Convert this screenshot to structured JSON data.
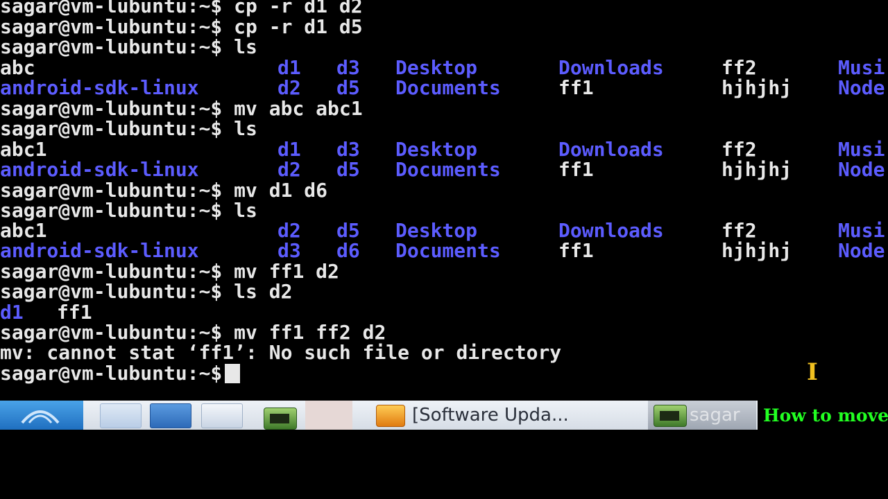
{
  "prompt": "sagar@vm-lubuntu:~$",
  "terminal": {
    "cmd1": " cp -r d1 d2",
    "cmd2": " cp -r d1 d5",
    "cmd3": " ls",
    "ls1_r1": [
      "abc",
      "d1",
      "d3",
      "Desktop",
      "Downloads",
      "ff2",
      "Musi"
    ],
    "ls1_r2": [
      "android-sdk-linux",
      "d2",
      "d5",
      "Documents",
      "ff1",
      "hjhjhj",
      "Node"
    ],
    "cmd4": " mv abc abc1",
    "cmd5": " ls",
    "ls2_r1": [
      "abc1",
      "d1",
      "d3",
      "Desktop",
      "Downloads",
      "ff2",
      "Musi"
    ],
    "ls2_r2": [
      "android-sdk-linux",
      "d2",
      "d5",
      "Documents",
      "ff1",
      "hjhjhj",
      "Node"
    ],
    "cmd6": " mv d1 d6",
    "cmd7": " ls",
    "ls3_r1": [
      "abc1",
      "d2",
      "d5",
      "Desktop",
      "Downloads",
      "ff2",
      "Musi"
    ],
    "ls3_r2": [
      "android-sdk-linux",
      "d3",
      "d6",
      "Documents",
      "ff1",
      "hjhjhj",
      "Node"
    ],
    "cmd8": " mv ff1 d2",
    "cmd9": " ls d2",
    "ls4": [
      "d1",
      "ff1"
    ],
    "cmd10": " mv ff1 ff2 d2",
    "error": "mv: cannot stat ‘ff1’: No such file or directory",
    "cmd11": ""
  },
  "taskbar": {
    "update_task": "[Software Upda...",
    "terminal_task": "sagar"
  },
  "caption": "How to move",
  "colors": {
    "dir": "#5c5cff",
    "text": "#e8e8e8",
    "caption": "#22ff22"
  }
}
